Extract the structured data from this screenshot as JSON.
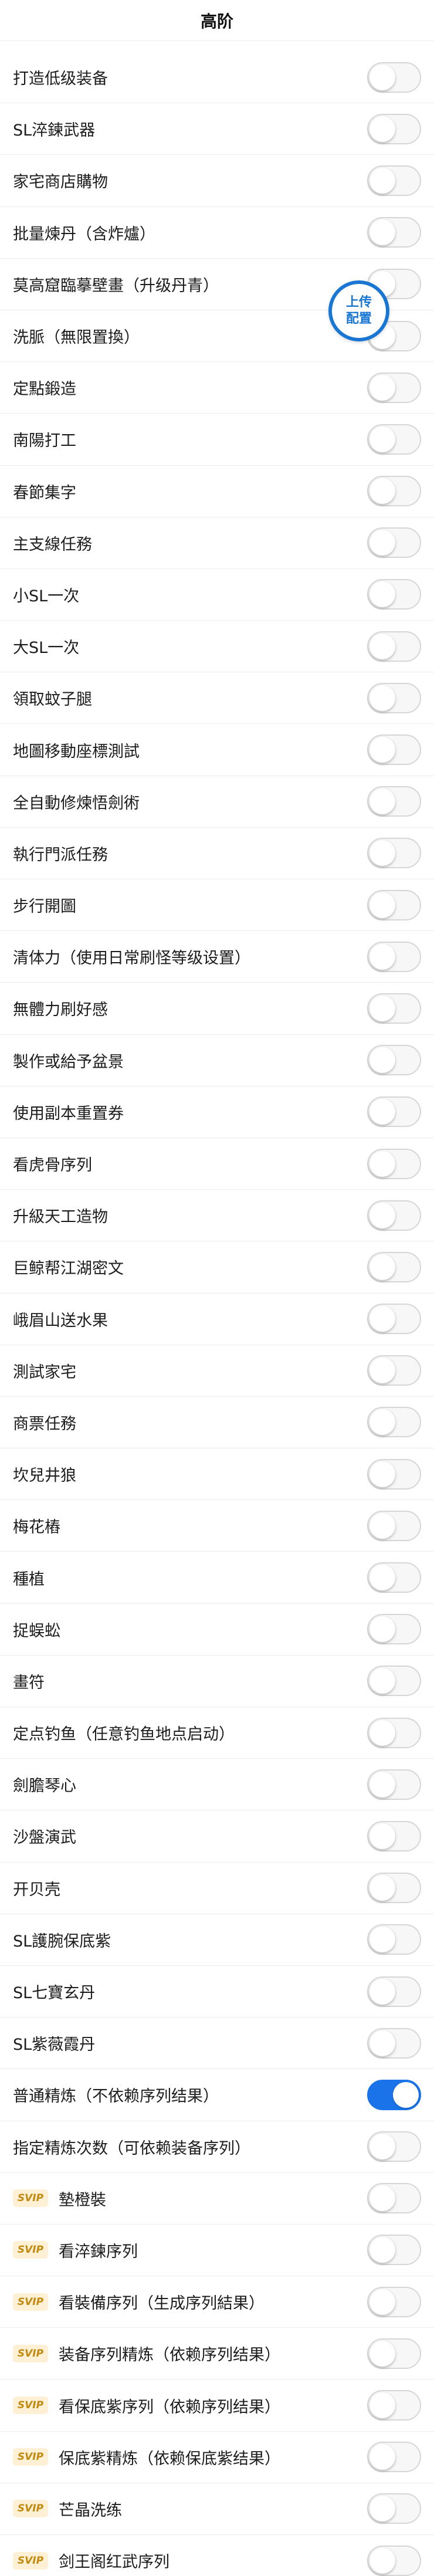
{
  "header": {
    "title": "高阶"
  },
  "float_button": {
    "line1": "上传",
    "line2": "配置"
  },
  "colors": {
    "accent": "#1a73e8",
    "svip_bg": "#fdf0d5",
    "svip_text": "#c48a0f"
  },
  "items": [
    {
      "label": "打造低级装备",
      "on": false,
      "svip": false
    },
    {
      "label": "SL淬鍊武器",
      "on": false,
      "svip": false
    },
    {
      "label": "家宅商店購物",
      "on": false,
      "svip": false
    },
    {
      "label": "批量煉丹（含炸爐）",
      "on": false,
      "svip": false
    },
    {
      "label": "莫高窟臨摹壁畫（升级丹青）",
      "on": false,
      "svip": false
    },
    {
      "label": "洗脈（無限置換）",
      "on": false,
      "svip": false
    },
    {
      "label": "定點鍛造",
      "on": false,
      "svip": false
    },
    {
      "label": "南陽打工",
      "on": false,
      "svip": false
    },
    {
      "label": "春節集字",
      "on": false,
      "svip": false
    },
    {
      "label": "主支線任務",
      "on": false,
      "svip": false
    },
    {
      "label": "小SL一次",
      "on": false,
      "svip": false
    },
    {
      "label": "大SL一次",
      "on": false,
      "svip": false
    },
    {
      "label": "領取蚊子腿",
      "on": false,
      "svip": false
    },
    {
      "label": "地圖移動座標測試",
      "on": false,
      "svip": false
    },
    {
      "label": "全自動修煉悟劍術",
      "on": false,
      "svip": false
    },
    {
      "label": "執行門派任務",
      "on": false,
      "svip": false
    },
    {
      "label": "步行開圖",
      "on": false,
      "svip": false
    },
    {
      "label": "清体力（使用日常刷怪等级设置）",
      "on": false,
      "svip": false
    },
    {
      "label": "無體力刷好感",
      "on": false,
      "svip": false
    },
    {
      "label": "製作或給予盆景",
      "on": false,
      "svip": false
    },
    {
      "label": "使用副本重置券",
      "on": false,
      "svip": false
    },
    {
      "label": "看虎骨序列",
      "on": false,
      "svip": false
    },
    {
      "label": "升級天工造物",
      "on": false,
      "svip": false
    },
    {
      "label": "巨鲸帮江湖密文",
      "on": false,
      "svip": false
    },
    {
      "label": "峨眉山送水果",
      "on": false,
      "svip": false
    },
    {
      "label": "測試家宅",
      "on": false,
      "svip": false
    },
    {
      "label": "商票任務",
      "on": false,
      "svip": false
    },
    {
      "label": "坎兒井狼",
      "on": false,
      "svip": false
    },
    {
      "label": "梅花樁",
      "on": false,
      "svip": false
    },
    {
      "label": "種植",
      "on": false,
      "svip": false
    },
    {
      "label": "捉蜈蚣",
      "on": false,
      "svip": false
    },
    {
      "label": "畫符",
      "on": false,
      "svip": false
    },
    {
      "label": "定点钓鱼（任意钓鱼地点启动）",
      "on": false,
      "svip": false
    },
    {
      "label": "劍膽琴心",
      "on": false,
      "svip": false
    },
    {
      "label": "沙盤演武",
      "on": false,
      "svip": false
    },
    {
      "label": "开贝壳",
      "on": false,
      "svip": false
    },
    {
      "label": "SL護腕保底紫",
      "on": false,
      "svip": false
    },
    {
      "label": "SL七寶玄丹",
      "on": false,
      "svip": false
    },
    {
      "label": "SL紫薇霞丹",
      "on": false,
      "svip": false
    },
    {
      "label": "普通精炼（不依赖序列结果）",
      "on": true,
      "svip": false
    },
    {
      "label": "指定精炼次数（可依赖装备序列）",
      "on": false,
      "svip": false
    },
    {
      "label": "墊橙裝",
      "on": false,
      "svip": true
    },
    {
      "label": "看淬鍊序列",
      "on": false,
      "svip": true
    },
    {
      "label": "看裝備序列（生成序列結果）",
      "on": false,
      "svip": true
    },
    {
      "label": "装备序列精炼（依赖序列结果）",
      "on": false,
      "svip": true
    },
    {
      "label": "看保底紫序列（依赖序列结果）",
      "on": false,
      "svip": true
    },
    {
      "label": "保底紫精炼（依赖保底紫结果）",
      "on": false,
      "svip": true
    },
    {
      "label": "芒晶洗练",
      "on": false,
      "svip": true
    },
    {
      "label": "剑王阁红武序列",
      "on": false,
      "svip": true
    }
  ],
  "svip_label": "SVIP"
}
